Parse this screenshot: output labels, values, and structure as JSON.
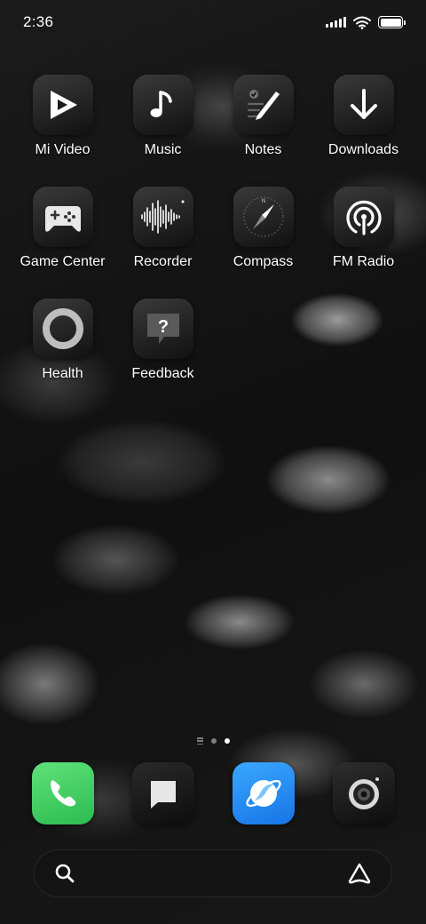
{
  "status_bar": {
    "time": "2:36",
    "battery_level": 1.0
  },
  "apps": [
    {
      "label": "Mi Video",
      "icon": "play-icon"
    },
    {
      "label": "Music",
      "icon": "music-note-icon"
    },
    {
      "label": "Notes",
      "icon": "notes-pen-icon"
    },
    {
      "label": "Downloads",
      "icon": "download-arrow-icon"
    },
    {
      "label": "Game Center",
      "icon": "gamepad-icon"
    },
    {
      "label": "Recorder",
      "icon": "waveform-icon"
    },
    {
      "label": "Compass",
      "icon": "compass-icon"
    },
    {
      "label": "FM Radio",
      "icon": "radio-broadcast-icon"
    },
    {
      "label": "Health",
      "icon": "ring-icon"
    },
    {
      "label": "Feedback",
      "icon": "question-bubble-icon"
    }
  ],
  "page_indicator": {
    "pages": 2,
    "current": 2
  },
  "dock": [
    {
      "app": "Phone",
      "icon": "phone-icon",
      "color": "#34c759"
    },
    {
      "app": "Messages",
      "icon": "message-bubble-icon",
      "color": "#111111"
    },
    {
      "app": "Browser",
      "icon": "planet-icon",
      "color": "#1e90ff"
    },
    {
      "app": "Camera",
      "icon": "camera-lens-icon",
      "color": "#111111"
    }
  ],
  "search_bar": {
    "left_icon": "search-icon",
    "right_icon": "assistant-icon"
  }
}
